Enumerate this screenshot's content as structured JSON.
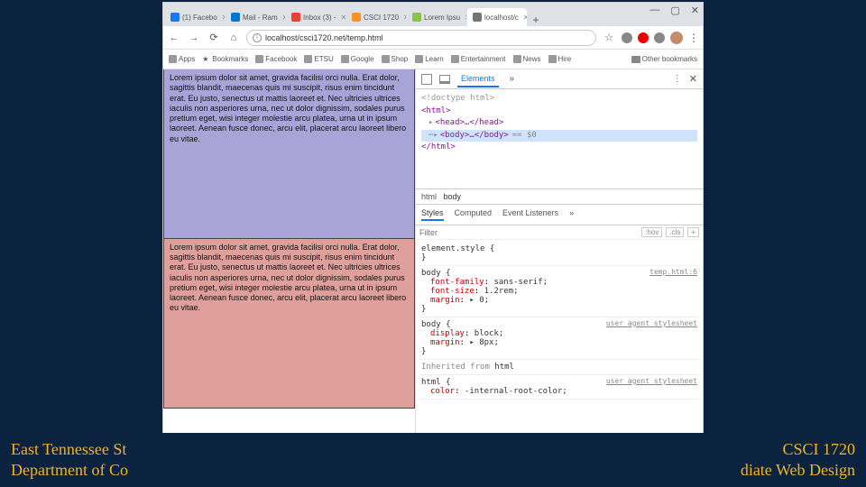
{
  "footer": {
    "left_line1": "East Tennessee St",
    "left_line2": "Department of Co",
    "right_line1": "CSCI 1720",
    "right_line2": "diate Web Design"
  },
  "window": {
    "controls": {
      "min": "—",
      "max": "▢",
      "close": "✕"
    }
  },
  "tabs": [
    {
      "label": "(1) Facebo",
      "fav": "fav-fb"
    },
    {
      "label": "Mail - Ram",
      "fav": "fav-out"
    },
    {
      "label": "Inbox (3) -",
      "fav": "fav-gm"
    },
    {
      "label": "CSCI 1720",
      "fav": "fav-cs"
    },
    {
      "label": "Lorem Ipsu",
      "fav": "fav-lo"
    },
    {
      "label": "localhost/c",
      "fav": "fav-loc",
      "active": true
    }
  ],
  "new_tab": "+",
  "toolbar": {
    "back": "←",
    "fwd": "→",
    "reload": "⟳",
    "home": "⌂",
    "url": "localhost/csci1720.net/temp.html",
    "star": "☆",
    "menu": "⋮"
  },
  "bookmarks": {
    "apps": "Apps",
    "items": [
      "Bookmarks",
      "Facebook",
      "ETSU",
      "Google",
      "Shop",
      "Learn",
      "Entertainment",
      "News",
      "Hire"
    ],
    "other": "Other bookmarks"
  },
  "lorem": "Lorem ipsum dolor sit amet, gravida facilisi orci nulla. Erat dolor, sagittis blandit, maecenas quis mi suscipit, risus enim tincidunt erat. Eu justo, senectus ut mattis laoreet et. Nec ultricies ultrices iaculis non asperiores urna, nec ut dolor dignissim, sodales purus pretium eget, wisi integer molestie arcu platea, urna ut in ipsum laoreet. Aenean fusce donec, arcu elit, placerat arcu laoreet libero eu vitae.",
  "devtools": {
    "tabs": {
      "elements": "Elements",
      "more": "»",
      "settings": "⋮",
      "close": "✕"
    },
    "dom": {
      "doctype": "<!doctype html>",
      "html_open": "<html>",
      "head": "<head>…</head>",
      "body": "<body>…</body>",
      "eq": "== $0",
      "html_close": "</html>"
    },
    "crumb": {
      "html": "html",
      "body": "body"
    },
    "styles_tabs": {
      "styles": "Styles",
      "computed": "Computed",
      "events": "Event Listeners",
      "more": "»"
    },
    "filter": {
      "placeholder": "Filter",
      "hov": ":hov",
      "cls": ".cls",
      "plus": "+"
    },
    "rules": {
      "element_style": "element.style",
      "body_src": "temp.html:6",
      "body_sel": "body",
      "ff_prop": "font-family",
      "ff_val": "sans-serif;",
      "fs_prop": "font-size",
      "fs_val": "1.2rem;",
      "mg_prop": "margin",
      "mg_val": "▸ 0;",
      "ua_label": "user agent stylesheet",
      "disp_prop": "display",
      "disp_val": "block;",
      "mg2_prop": "margin",
      "mg2_val": "▸ 8px;",
      "inherited": "Inherited from",
      "inherited_sel": "html",
      "html_sel": "html",
      "color_prop": "color",
      "color_val": "-internal-root-color;"
    }
  }
}
